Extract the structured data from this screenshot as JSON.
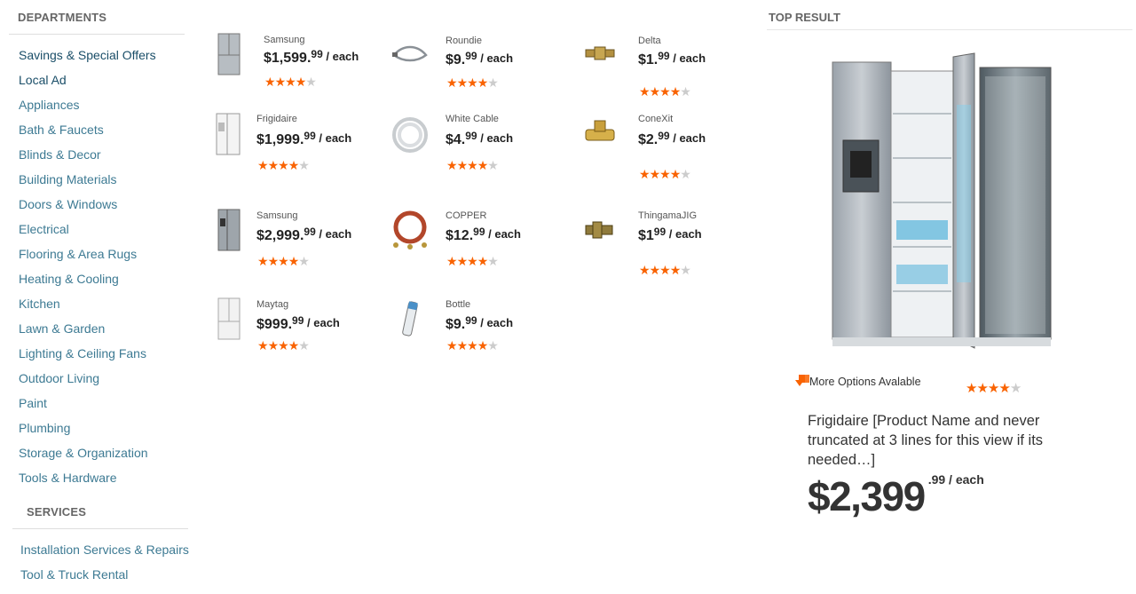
{
  "departments": {
    "heading": "DEPARTMENTS",
    "items": [
      "Savings & Special Offers",
      "Local Ad",
      "Appliances",
      "Bath & Faucets",
      "Blinds & Decor",
      "Building Materials",
      "Doors & Windows",
      "Electrical",
      "Flooring & Area Rugs",
      "Heating & Cooling",
      "Kitchen",
      "Lawn & Garden",
      "Lighting & Ceiling Fans",
      "Outdoor Living",
      "Paint",
      "Plumbing",
      "Storage & Organization",
      "Tools & Hardware"
    ]
  },
  "services": {
    "heading": "SERVICES",
    "items": [
      "Installation Services & Repairs",
      "Tool & Truck Rental"
    ]
  },
  "products": [
    {
      "brand": "Samsung",
      "dollars": "$1,599.",
      "cents": "99",
      "unit": " / each",
      "rating": 4,
      "icon": "fridge-french-door-stainless"
    },
    {
      "brand": "Roundie",
      "dollars": "$9.",
      "cents": "99",
      "unit": " / each",
      "rating": 4,
      "icon": "braided-hose"
    },
    {
      "brand": "Delta",
      "dollars": "$1.",
      "cents": "99",
      "unit": " / each",
      "rating": 4,
      "icon": "brass-fitting"
    },
    {
      "brand": "Frigidaire",
      "dollars": "$1,999.",
      "cents": "99",
      "unit": " / each",
      "rating": 4,
      "icon": "fridge-side-by-side-white"
    },
    {
      "brand": "White Cable",
      "dollars": "$4.",
      "cents": "99",
      "unit": " / each",
      "rating": 4,
      "icon": "coiled-white-tubing"
    },
    {
      "brand": "ConeXit",
      "dollars": "$2.",
      "cents": "99",
      "unit": " / each",
      "rating": 4,
      "icon": "brass-valve"
    },
    {
      "brand": "Samsung",
      "dollars": "$2,999.",
      "cents": "99",
      "unit": " / each",
      "rating": 4,
      "icon": "fridge-stainless-dispenser"
    },
    {
      "brand": "COPPER",
      "dollars": "$12.",
      "cents": "99",
      "unit": " / each",
      "rating": 4,
      "icon": "copper-tubing-kit"
    },
    {
      "brand": "ThingamaJIG",
      "dollars": "$1",
      "cents": "99",
      "unit": " / each",
      "rating": 4,
      "icon": "brass-adapter"
    },
    {
      "brand": "Maytag",
      "dollars": "$999.",
      "cents": "99",
      "unit": " / each",
      "rating": 4,
      "icon": "fridge-french-door-white"
    },
    {
      "brand": "Bottle",
      "dollars": "$9.",
      "cents": "99",
      "unit": " / each",
      "rating": 4,
      "icon": "water-filter-cartridge"
    }
  ],
  "top_result": {
    "heading": "TOP RESULT",
    "more_options": "More Options Avalable",
    "rating": 4,
    "name": "Frigidaire [Product Name and never truncated at 3 lines for this view if its needed…]",
    "dollars": "$2,399",
    "cents": ".99",
    "unit": " / each"
  },
  "colors": {
    "link": "#3d7a93",
    "star_on": "#f96302",
    "star_off": "#cccccc",
    "heading": "#666666"
  }
}
